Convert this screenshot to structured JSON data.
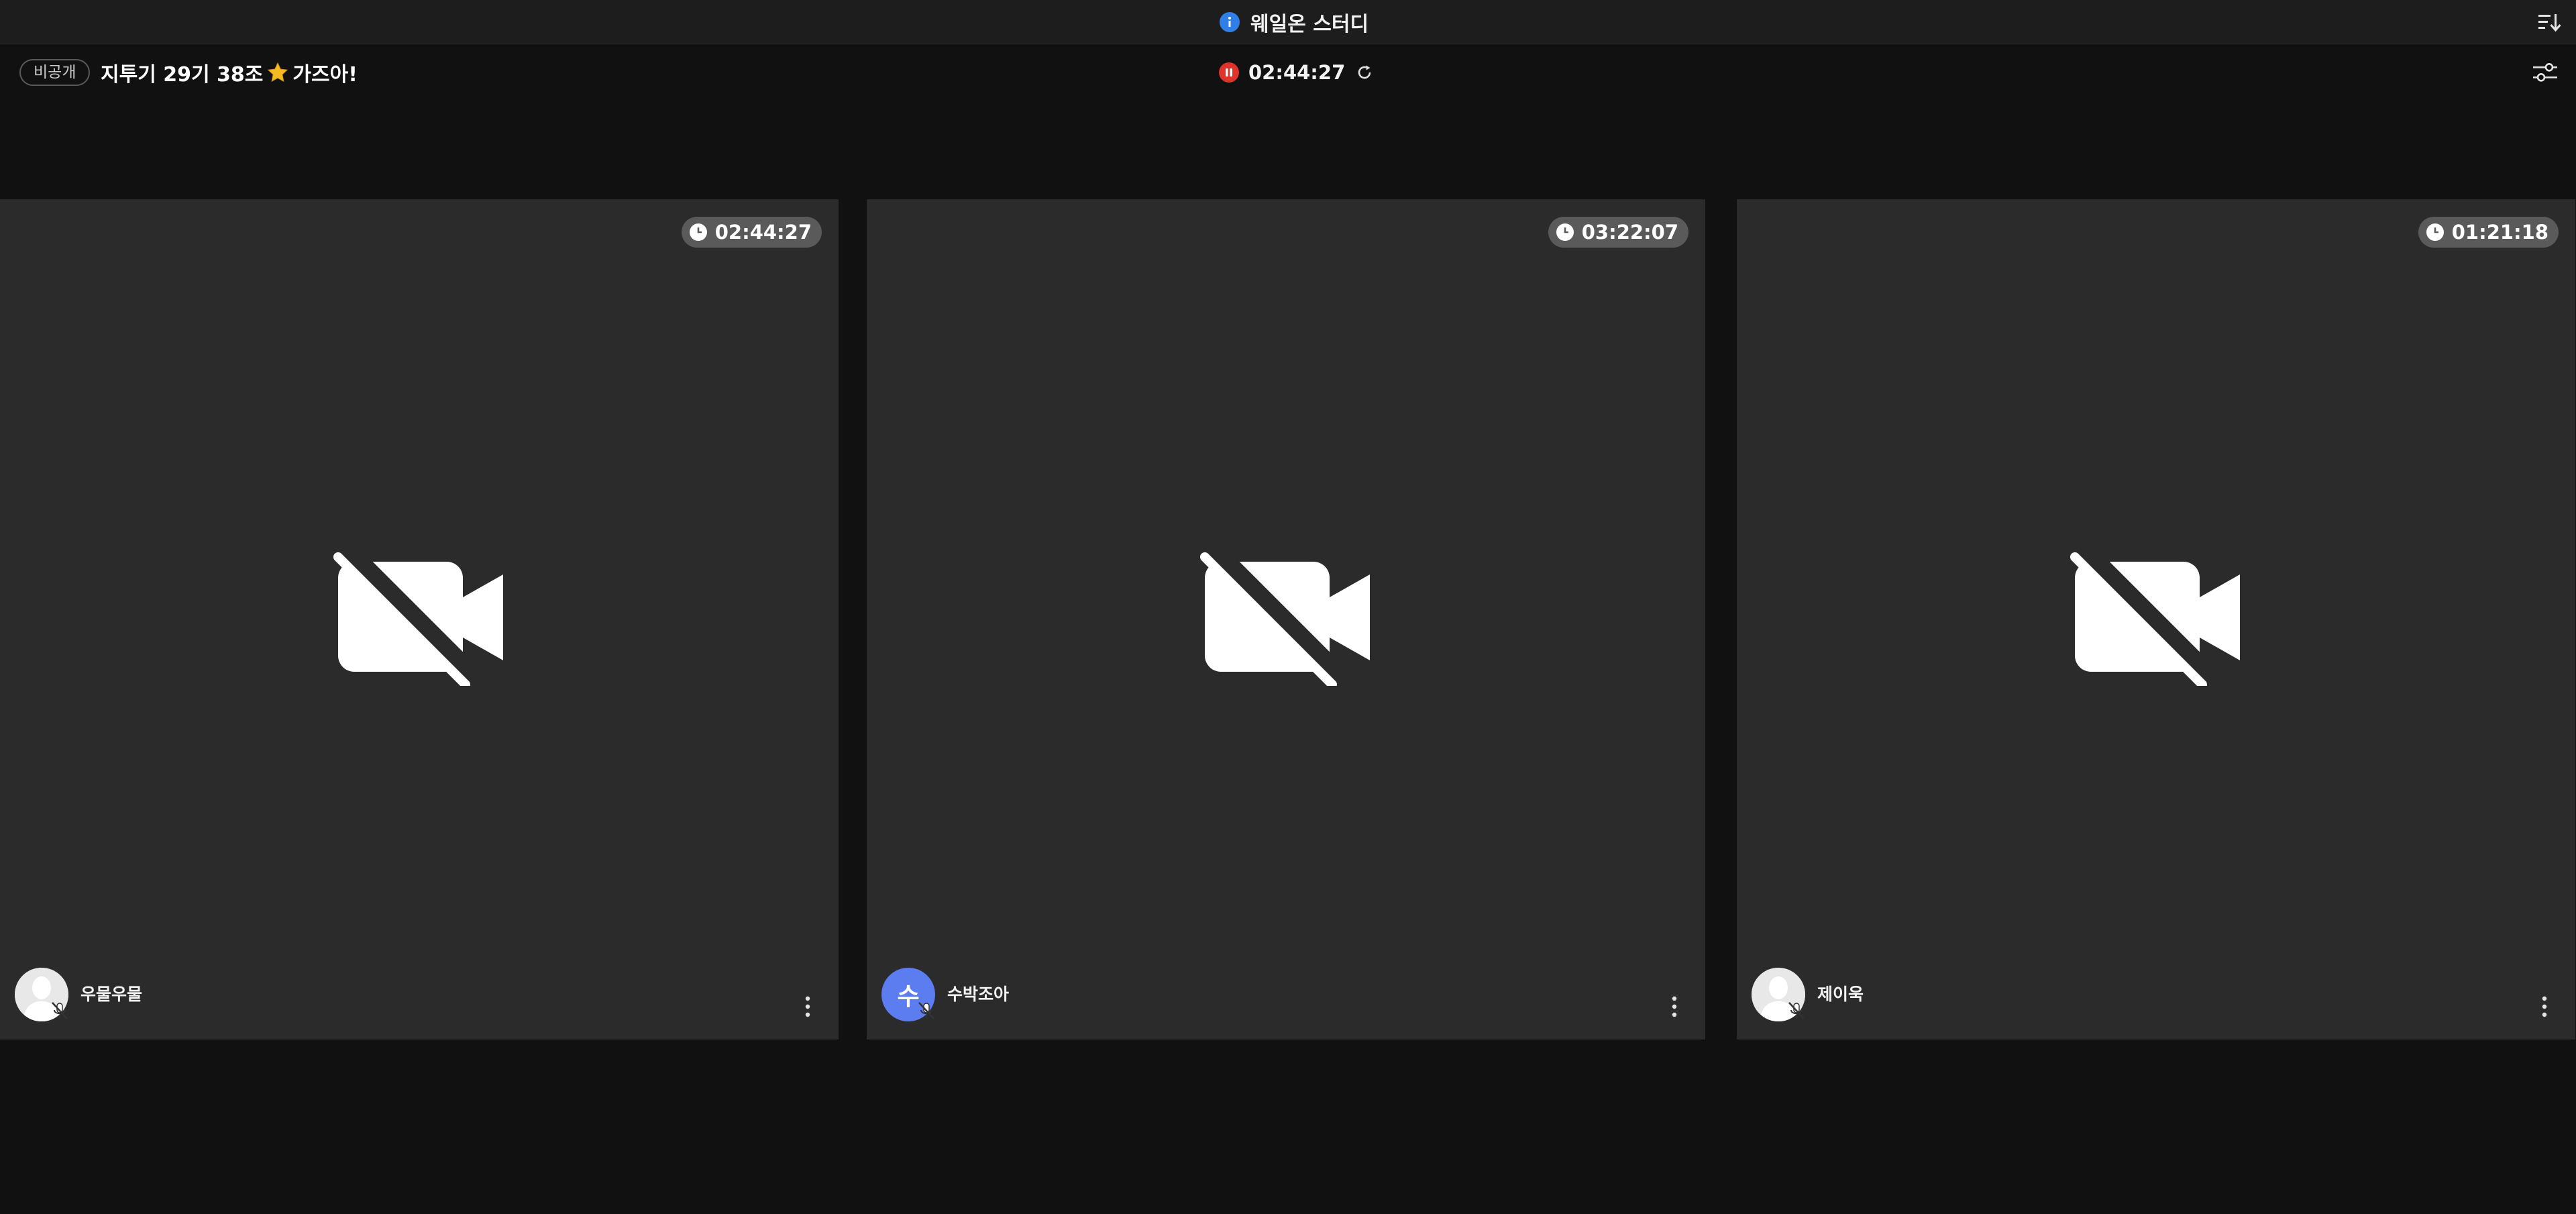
{
  "titlebar": {
    "title": "웨일온 스터디",
    "info_icon": "info-icon",
    "sort_icon": "sort-list-icon"
  },
  "room": {
    "visibility_badge": "비공개",
    "title_part1": "지투기 29기 38조",
    "title_emoji": "star-icon",
    "title_part2": "가즈아!",
    "total_timer": "02:44:27",
    "timer_state": "running",
    "pause_icon": "pause-icon",
    "refresh_icon": "refresh-icon",
    "settings_icon": "settings-sliders-icon"
  },
  "colors": {
    "background": "#111111",
    "tile": "#2b2b2b",
    "pause_red": "#e0342a",
    "info_blue": "#2f7fe6",
    "avatar_blue": "#5b7df0",
    "time_badge": "#5a5a5a"
  },
  "participants": [
    {
      "name": "우물우물",
      "study_time": "02:44:27",
      "avatar": "default-profile",
      "avatar_letter": "",
      "camera": "off",
      "mic": "off"
    },
    {
      "name": "수박조아",
      "study_time": "03:22:07",
      "avatar": "letter",
      "avatar_letter": "수",
      "camera": "off",
      "mic": "off"
    },
    {
      "name": "제이욱",
      "study_time": "01:21:18",
      "avatar": "default-profile",
      "avatar_letter": "",
      "camera": "off",
      "mic": "off"
    }
  ]
}
